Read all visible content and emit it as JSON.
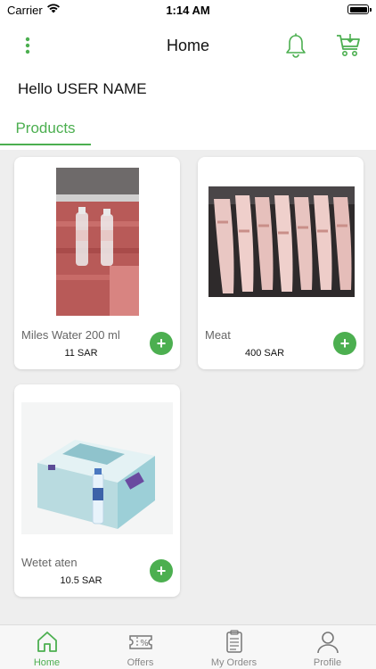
{
  "status_bar": {
    "carrier": "Carrier",
    "time": "1:14 AM"
  },
  "header": {
    "title": "Home"
  },
  "greeting": "Hello USER NAME",
  "section_tab": "Products",
  "products": [
    {
      "name": "Miles Water 200 ml",
      "price": "11 SAR"
    },
    {
      "name": "Meat",
      "price": "400 SAR"
    },
    {
      "name": "Wetet aten",
      "price": "10.5 SAR"
    }
  ],
  "add_label": "+",
  "bottom_tabs": [
    {
      "label": "Home",
      "active": true
    },
    {
      "label": "Offers"
    },
    {
      "label": "My Orders"
    },
    {
      "label": "Profile"
    }
  ],
  "colors": {
    "accent": "#4caf50",
    "background": "#eeeeee"
  }
}
